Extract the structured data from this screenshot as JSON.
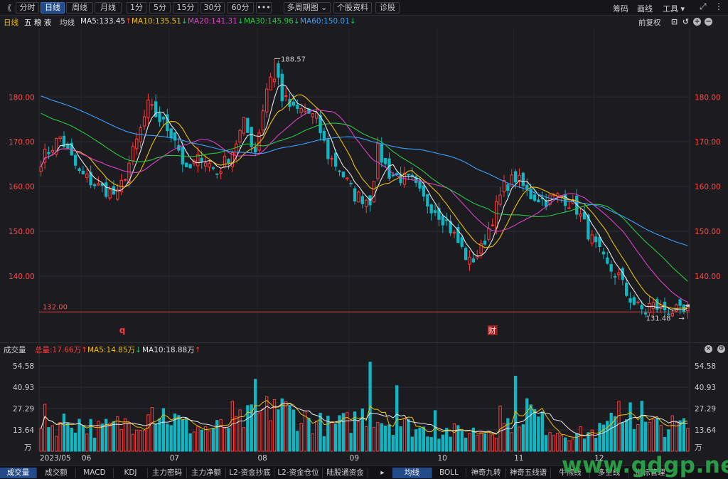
{
  "toolbar": {
    "back_icon": "double-left-chevron-icon",
    "left_items": [
      "分时",
      "日线",
      "周线",
      "月线",
      "1分",
      "5分",
      "15分",
      "30分",
      "60分",
      "•••",
      "多周期图 ⌄",
      "个股资料",
      "诊股"
    ],
    "active_item": "日线",
    "right_items": [
      "筹码",
      "画线",
      "工具 ▾"
    ],
    "expand_icon": "expand-icon",
    "more_icon": "more-icon"
  },
  "price_legend": {
    "period": "日线",
    "stock_name": "五 粮 液",
    "ma_type": "均线",
    "items": [
      {
        "text": "MA5:133.45",
        "arrow": "↑",
        "color": "#e6e6e6",
        "arrow_color": "#ff3b3b"
      },
      {
        "text": "MA10:135.51",
        "arrow": "↓",
        "color": "#f0c000",
        "arrow_color": "#1fc463"
      },
      {
        "text": "MA20:141.31",
        "arrow": "↓",
        "color": "#e040c8",
        "arrow_color": "#1fc463"
      },
      {
        "text": "MA30:145.96",
        "arrow": "↓",
        "color": "#28c840",
        "arrow_color": "#1fc463"
      },
      {
        "text": "MA60:150.01",
        "arrow": "↓",
        "color": "#3aa0ff",
        "arrow_color": "#1fc463"
      }
    ],
    "fq": "前复权",
    "icons": [
      "lock-icon",
      "undo-icon",
      "zoom-in-icon",
      "zoom-out-icon"
    ]
  },
  "volume_legend": {
    "title": "成交量",
    "total": "总量:17.66万",
    "total_arrow": "↑",
    "ma5": "MA5:14.85万",
    "ma5_arrow": "↓",
    "ma10": "MA10:18.88万",
    "ma10_arrow": "↑",
    "icons": [
      "close-icon",
      "settings-icon"
    ]
  },
  "price_axis": {
    "ticks": [
      "180.00",
      "170.00",
      "160.00",
      "150.00",
      "140.00"
    ],
    "tick_values": [
      180,
      170,
      160,
      150,
      140
    ],
    "range": [
      129.5,
      195.3
    ]
  },
  "volume_axis": {
    "ticks": [
      "54.58",
      "40.93",
      "27.29",
      "13.64"
    ],
    "tick_values": [
      54.58,
      40.93,
      27.29,
      13.64
    ],
    "unit": "万",
    "range": [
      0,
      61
    ]
  },
  "annotations": {
    "high": "188.57",
    "low": "131.48",
    "ref_line_label": "132.00",
    "ref_line_value": 132,
    "marker_q": "q",
    "marker_cai": "财",
    "current_marker": "◄"
  },
  "x_axis": {
    "labels": [
      "2023/05",
      "06",
      "07",
      "08",
      "09",
      "10",
      "11",
      "12"
    ],
    "label_index": [
      0,
      11,
      34,
      57,
      81,
      104,
      124,
      145
    ]
  },
  "bottom_tabs_left": [
    "成交量",
    "成交额",
    "MACD",
    "KDJ",
    "主力密码",
    "主力净额",
    "L2-资金抄底",
    "L2-资金仓位",
    "陆股通资金"
  ],
  "bottom_tabs_right": [
    "均线",
    "BOLL",
    "神奇九转",
    "神奇五线谱",
    "牛熊线",
    "多空线",
    "指标管理"
  ],
  "watermark": "www.gdgp.net",
  "chart_data": {
    "type": "candlestick",
    "series_count": 170,
    "close_anchors": [
      [
        0,
        166
      ],
      [
        5,
        171
      ],
      [
        10,
        163
      ],
      [
        15,
        160
      ],
      [
        20,
        158
      ],
      [
        25,
        170
      ],
      [
        28,
        178
      ],
      [
        31,
        175
      ],
      [
        35,
        171
      ],
      [
        38,
        163
      ],
      [
        42,
        167
      ],
      [
        46,
        163
      ],
      [
        50,
        168
      ],
      [
        53,
        174
      ],
      [
        56,
        168
      ],
      [
        59,
        182
      ],
      [
        61,
        188
      ],
      [
        63,
        180
      ],
      [
        66,
        177
      ],
      [
        69,
        177
      ],
      [
        72,
        175
      ],
      [
        75,
        167
      ],
      [
        78,
        164
      ],
      [
        82,
        158
      ],
      [
        86,
        157
      ],
      [
        88,
        168
      ],
      [
        91,
        163
      ],
      [
        94,
        162
      ],
      [
        97,
        161
      ],
      [
        100,
        157
      ],
      [
        103,
        155
      ],
      [
        106,
        152
      ],
      [
        110,
        146
      ],
      [
        112,
        143
      ],
      [
        115,
        146
      ],
      [
        118,
        153
      ],
      [
        121,
        160
      ],
      [
        124,
        162
      ],
      [
        128,
        158
      ],
      [
        132,
        157
      ],
      [
        136,
        158
      ],
      [
        140,
        155
      ],
      [
        144,
        148
      ],
      [
        148,
        142
      ],
      [
        151,
        140
      ],
      [
        153,
        136
      ],
      [
        156,
        133
      ],
      [
        158,
        132
      ],
      [
        159,
        133.5
      ]
    ],
    "volume_anchors": [
      [
        0,
        14
      ],
      [
        8,
        20
      ],
      [
        15,
        14
      ],
      [
        22,
        18
      ],
      [
        28,
        23
      ],
      [
        32,
        24
      ],
      [
        38,
        16
      ],
      [
        45,
        14
      ],
      [
        52,
        19
      ],
      [
        58,
        24
      ],
      [
        61,
        29
      ],
      [
        64,
        26
      ],
      [
        70,
        20
      ],
      [
        75,
        16
      ],
      [
        80,
        18
      ],
      [
        84,
        23
      ],
      [
        86,
        27
      ],
      [
        89,
        20
      ],
      [
        94,
        17
      ],
      [
        99,
        14
      ],
      [
        105,
        13
      ],
      [
        110,
        12
      ],
      [
        115,
        13
      ],
      [
        121,
        16
      ],
      [
        124,
        23
      ],
      [
        127,
        28
      ],
      [
        131,
        18
      ],
      [
        136,
        12
      ],
      [
        141,
        11
      ],
      [
        146,
        13
      ],
      [
        150,
        19
      ],
      [
        154,
        22
      ],
      [
        157,
        17
      ],
      [
        159,
        16
      ]
    ],
    "volume_spikes": [
      [
        1,
        30
      ],
      [
        29,
        28
      ],
      [
        50,
        32
      ],
      [
        56,
        46
      ],
      [
        61,
        33
      ],
      [
        86,
        57
      ],
      [
        93,
        42
      ],
      [
        103,
        26
      ],
      [
        120,
        29
      ],
      [
        124,
        48
      ],
      [
        151,
        32
      ],
      [
        154,
        31
      ],
      [
        157,
        32
      ]
    ],
    "ma_colors": {
      "MA5": "#e6e6e6",
      "MA10": "#f0c000",
      "MA20": "#e040c8",
      "MA30": "#28c840",
      "MA60": "#3aa0ff"
    },
    "up_color": "#ff3b3b",
    "down_color": "#10b6c2",
    "grid": true
  }
}
